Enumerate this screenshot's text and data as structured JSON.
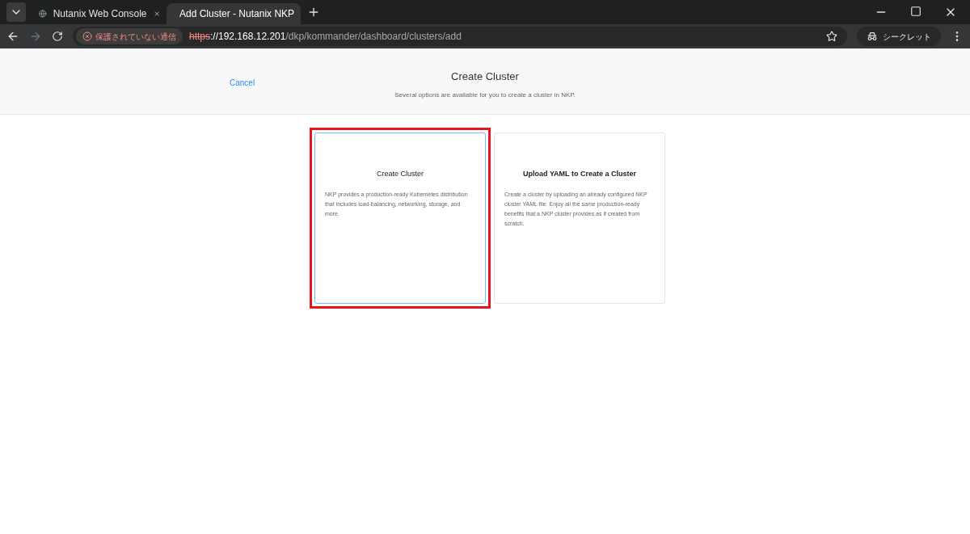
{
  "browser": {
    "tabs": [
      {
        "title": "Nutanix Web Console",
        "selected": false,
        "kind": "web"
      },
      {
        "title": "Add Cluster - Nutanix NKP",
        "selected": true,
        "kind": "app"
      }
    ],
    "security_chip": "保護されていない通信",
    "url": {
      "scheme": "https",
      "host": "://192.168.12.201",
      "path": "/dkp/kommander/dashboard/clusters/add"
    },
    "incognito_label": "シークレット"
  },
  "header": {
    "cancel": "Cancel",
    "title": "Create Cluster",
    "subtitle": "Several options are available for you to create a cluster in NKP."
  },
  "cards": [
    {
      "title": "Create Cluster",
      "description": "NKP provides a production-ready Kubernetes distribution that includes load-balancing, networking, storage, and more.",
      "selected": true,
      "highlighted": true
    },
    {
      "title": "Upload YAML to Create a Cluster",
      "description": "Create a cluster by uploading an already configured NKP cluster YAML file. Enjoy all the same production-ready benefits that a NKP cluster provides as if created from scratch.",
      "selected": false,
      "highlighted": false
    }
  ]
}
